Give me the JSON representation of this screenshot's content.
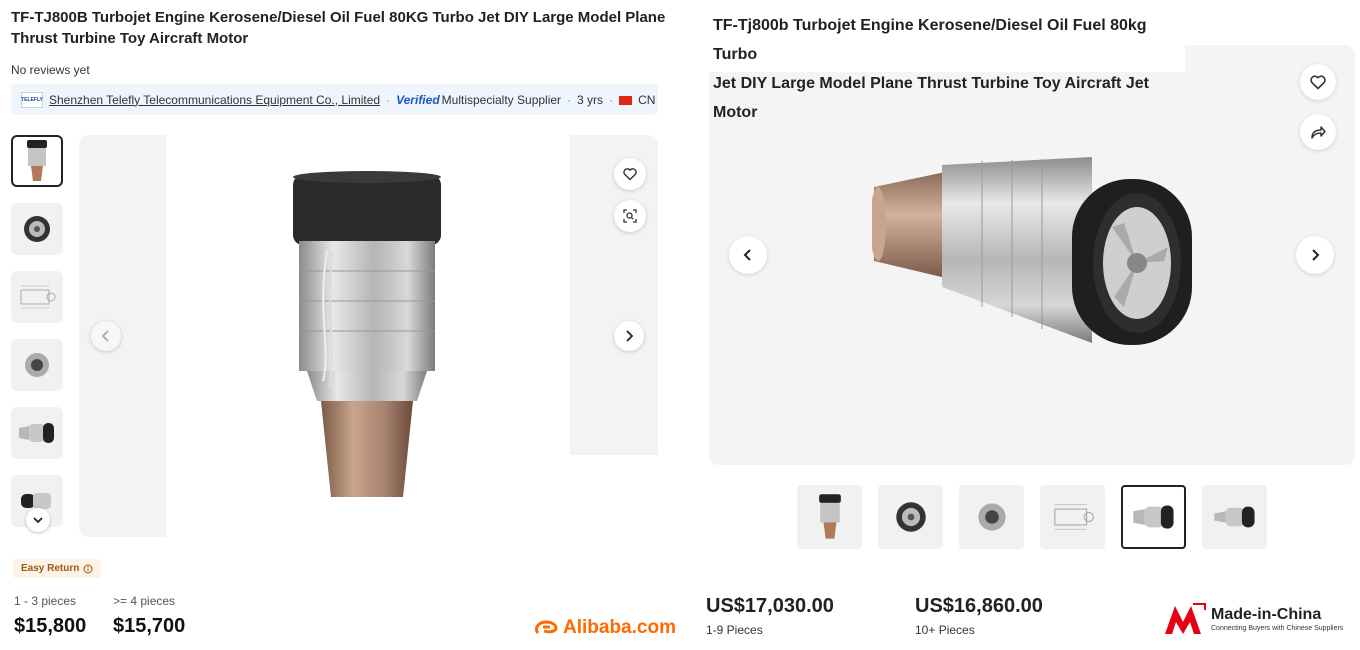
{
  "alibaba": {
    "title": "TF-TJ800B Turbojet Engine Kerosene/Diesel Oil Fuel 80KG Turbo Jet DIY Large Model Plane Thrust Turbine Toy Aircraft Motor",
    "reviews": "No reviews yet",
    "supplier": {
      "logo_text": "TELEFLY",
      "name": "Shenzhen Telefly Telecommunications Equipment Co., Limited",
      "verified_label": "Verified",
      "type": "Multispecialty Supplier",
      "years": "3 yrs",
      "country": "CN"
    },
    "thumbnails": [
      {
        "icon": "engine-vertical-thumb"
      },
      {
        "icon": "engine-front-thumb"
      },
      {
        "icon": "engine-drawing-thumb"
      },
      {
        "icon": "engine-nozzle-thumb"
      },
      {
        "icon": "engine-side-thumb"
      },
      {
        "icon": "engine-rear-thumb"
      }
    ],
    "easy_return": "Easy Return",
    "tiers": [
      {
        "qty": "1 - 3 pieces",
        "price": "$15,800"
      },
      {
        "qty": ">= 4 pieces",
        "price": "$15,700"
      }
    ],
    "brand": "Alibaba.com",
    "brand_color": "#ff6a00"
  },
  "made_in_china": {
    "title_line1": "TF-Tj800b Turbojet Engine Kerosene/Diesel Oil Fuel 80kg Turbo",
    "title_line2": "Jet DIY Large Model Plane Thrust Turbine Toy Aircraft Jet Motor",
    "thumbnails": [
      {
        "icon": "engine-vertical-thumb"
      },
      {
        "icon": "engine-front-thumb"
      },
      {
        "icon": "engine-nozzle-thumb"
      },
      {
        "icon": "engine-drawing-thumb"
      },
      {
        "icon": "engine-side-thumb"
      },
      {
        "icon": "engine-rear-thumb"
      }
    ],
    "tiers": [
      {
        "price": "US$17,030.00",
        "qty": "1-9 Pieces"
      },
      {
        "price": "US$16,860.00",
        "qty": "10+ Pieces"
      }
    ],
    "brand": "Made-in-China",
    "brand_tagline": "Connecting Buyers with Chinese Suppliers",
    "brand_color": "#e60012"
  }
}
